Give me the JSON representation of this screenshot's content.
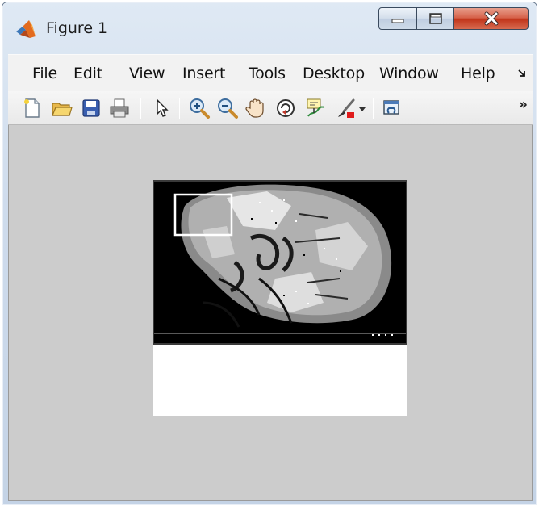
{
  "window": {
    "title": "Figure 1",
    "controls": [
      "minimize",
      "maximize",
      "close"
    ]
  },
  "menubar": {
    "items": [
      "File",
      "Edit",
      "View",
      "Insert",
      "Tools",
      "Desktop",
      "Window",
      "Help"
    ],
    "overflow_icon": "chevron-more-icon"
  },
  "toolbar": {
    "buttons": [
      "new-figure-icon",
      "open-file-icon",
      "save-icon",
      "print-icon",
      "edit-plot-arrow-icon",
      "zoom-in-icon",
      "zoom-out-icon",
      "pan-hand-icon",
      "rotate-3d-icon",
      "data-cursor-icon",
      "brush-icon",
      "brush-dropdown-icon",
      "link-plot-icon"
    ],
    "overflow": "»"
  },
  "figure": {
    "content": "grayscale medical image of skull with blood vessels, with a rectangular selection box in the upper-left",
    "colors": {
      "background": "#cccccc",
      "plot_bg": "#ffffff",
      "image_bg": "#000000",
      "selection": "#ffffff"
    }
  }
}
